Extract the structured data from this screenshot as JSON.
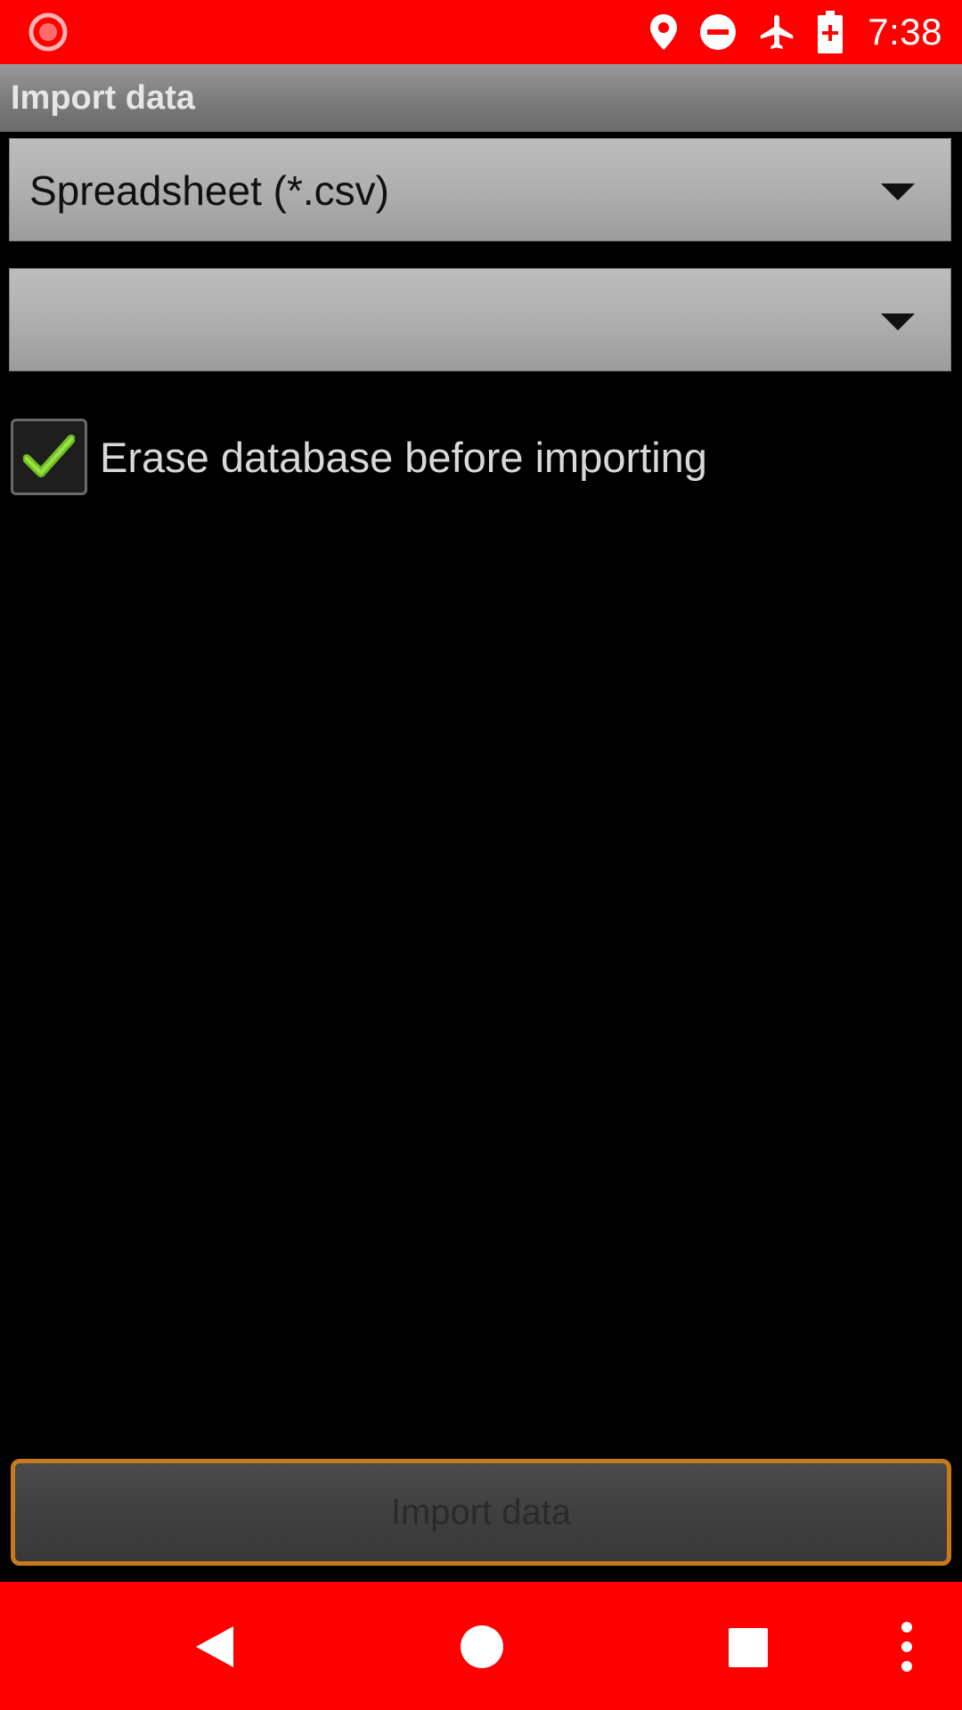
{
  "status_bar": {
    "time": "7:38",
    "color": "#ff0000",
    "icons": [
      "screen-record-icon",
      "location-icon",
      "do-not-disturb-icon",
      "airplane-mode-icon",
      "battery-charging-icon"
    ]
  },
  "title_bar": {
    "title": "Import data"
  },
  "format_spinner": {
    "selected": "Spreadsheet (*.csv)"
  },
  "file_spinner": {
    "selected": ""
  },
  "erase_option": {
    "label": "Erase database before importing",
    "checked": true
  },
  "import_button": {
    "label": "Import data",
    "enabled": false,
    "accent": "#c8791c"
  },
  "nav_bar": {
    "color": "#ff0000",
    "icons": [
      "back-icon",
      "home-icon",
      "recents-icon",
      "more-options-icon"
    ]
  }
}
